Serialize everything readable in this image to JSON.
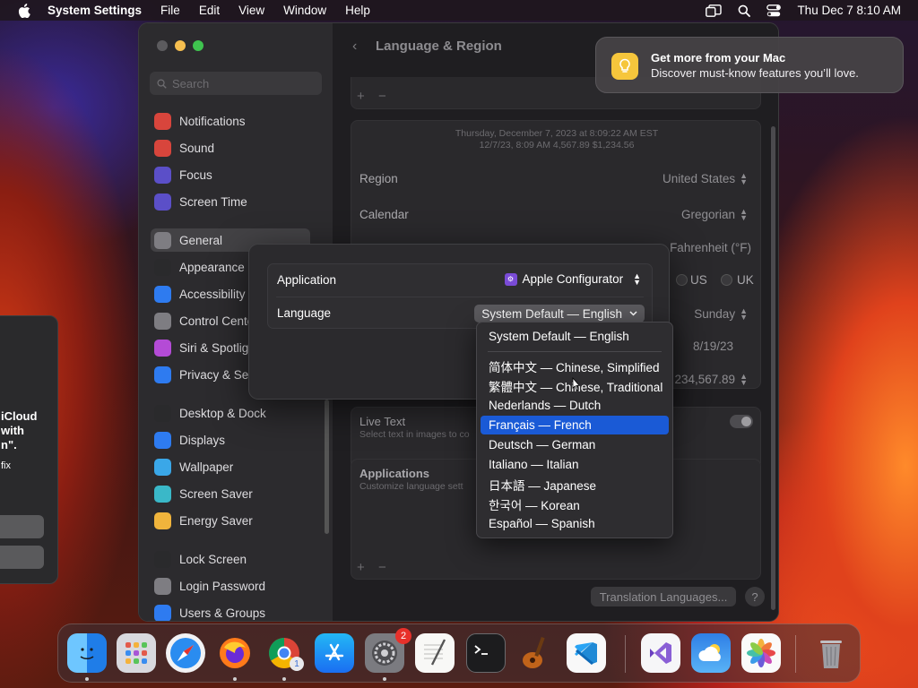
{
  "menubar": {
    "app_name": "System Settings",
    "menus": [
      "File",
      "Edit",
      "View",
      "Window",
      "Help"
    ],
    "datetime": "Thu Dec 7  8:10 AM"
  },
  "notification": {
    "title": "Get more from your Mac",
    "body": "Discover must-know features you’ll love."
  },
  "left_dialog": {
    "line1": "iCloud",
    "line2": "with",
    "line3": "n\".",
    "line4": "fix"
  },
  "settings": {
    "search_placeholder": "Search",
    "sidebar": [
      {
        "label": "Notifications",
        "icon": "bell-icon",
        "color": "#d8453c"
      },
      {
        "label": "Sound",
        "icon": "speaker-icon",
        "color": "#d8453c"
      },
      {
        "label": "Focus",
        "icon": "moon-icon",
        "color": "#5b4fc8"
      },
      {
        "label": "Screen Time",
        "icon": "hourglass-icon",
        "color": "#5b4fc8"
      },
      {
        "label": "General",
        "icon": "gear-icon",
        "color": "#7e7d82"
      },
      {
        "label": "Appearance",
        "icon": "appearance-icon",
        "color": "#2a2a2c"
      },
      {
        "label": "Accessibility",
        "icon": "accessibility-icon",
        "color": "#2e7bf0"
      },
      {
        "label": "Control Cente",
        "icon": "control-center-icon",
        "color": "#7e7d82"
      },
      {
        "label": "Siri & Spotlig",
        "icon": "siri-icon",
        "color": "#b44bd6"
      },
      {
        "label": "Privacy & Sec",
        "icon": "hand-icon",
        "color": "#2e7bf0"
      },
      {
        "label": "Desktop & Dock",
        "icon": "dock-icon",
        "color": "#2a2a2c"
      },
      {
        "label": "Displays",
        "icon": "display-icon",
        "color": "#2e7bf0"
      },
      {
        "label": "Wallpaper",
        "icon": "wallpaper-icon",
        "color": "#3aa7e8"
      },
      {
        "label": "Screen Saver",
        "icon": "screen-saver-icon",
        "color": "#3ab8c8"
      },
      {
        "label": "Energy Saver",
        "icon": "battery-icon",
        "color": "#f0b43c"
      },
      {
        "label": "Lock Screen",
        "icon": "lock-icon",
        "color": "#2a2a2c"
      },
      {
        "label": "Login Password",
        "icon": "key-icon",
        "color": "#7e7d82"
      },
      {
        "label": "Users & Groups",
        "icon": "users-icon",
        "color": "#2e7bf0"
      }
    ],
    "content": {
      "title": "Language & Region",
      "preview_line1": "Thursday, December 7, 2023 at 8:09:22 AM EST",
      "preview_line2": "12/7/23, 8:09 AM     4,567.89     $1,234.56",
      "region_label": "Region",
      "region_value": "United States",
      "calendar_label": "Calendar",
      "calendar_value": "Gregorian",
      "temperature_value": "Fahrenheit (°F)",
      "measurement_us": "US",
      "measurement_uk": "UK",
      "first_day_value": "Sunday",
      "date_format_value": "8/19/23",
      "number_format_value": "234,567.89",
      "live_text_label": "Live Text",
      "live_text_desc": "Select text in images to co",
      "apps_label": "Applications",
      "apps_desc": "Customize language sett",
      "translation_button": "Translation Languages...",
      "help": "?"
    }
  },
  "sheet": {
    "application_label": "Application",
    "application_value": "Apple Configurator",
    "language_label": "Language",
    "language_value": "System Default — English"
  },
  "language_menu": {
    "items": [
      "System Default — English",
      "简体中文 — Chinese, Simplified",
      "繁體中文 — Chinese, Traditional",
      "Nederlands — Dutch",
      "Français — French",
      "Deutsch — German",
      "Italiano — Italian",
      "日本語 — Japanese",
      "한국어 — Korean",
      "Español — Spanish"
    ],
    "highlighted": "Français — French"
  },
  "dock": {
    "apps": [
      {
        "name": "finder-icon"
      },
      {
        "name": "launchpad-icon"
      },
      {
        "name": "safari-icon"
      },
      {
        "name": "firefox-icon"
      },
      {
        "name": "chrome-icon",
        "badge": "1"
      },
      {
        "name": "app-store-icon"
      },
      {
        "name": "system-settings-icon",
        "badge": "2"
      },
      {
        "name": "textedit-icon"
      },
      {
        "name": "terminal-icon"
      },
      {
        "name": "garageband-icon"
      },
      {
        "name": "vscode-icon"
      },
      {
        "name": "visual-studio-icon"
      },
      {
        "name": "weather-icon"
      },
      {
        "name": "photos-icon"
      },
      {
        "name": "trash-icon"
      }
    ]
  }
}
